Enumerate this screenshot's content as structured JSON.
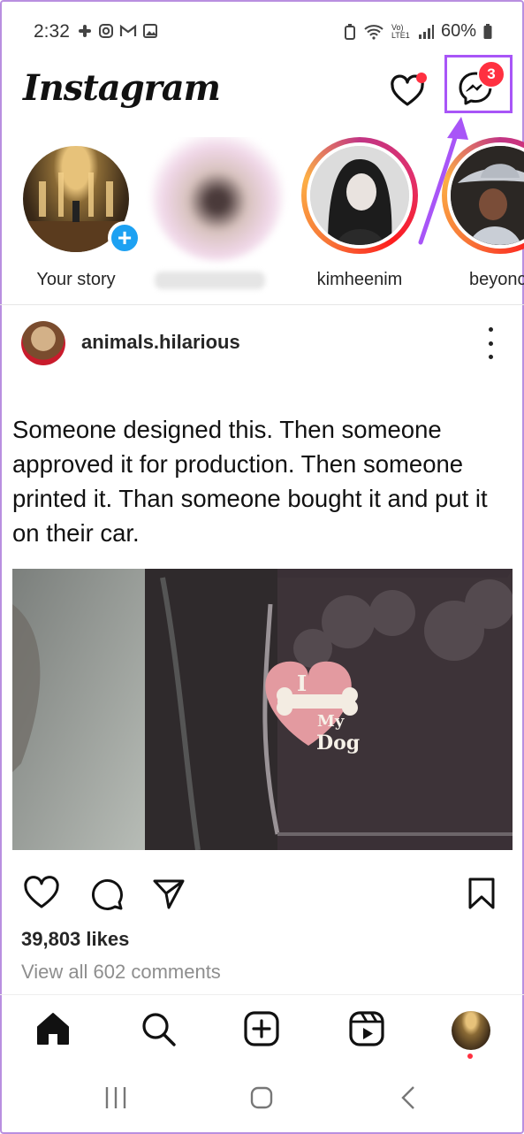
{
  "status_bar": {
    "time": "2:32",
    "battery": "60%",
    "network": "Vo) LTE1"
  },
  "header": {
    "logo": "Instagram",
    "messages_badge": "3"
  },
  "stories": [
    {
      "label": "Your story"
    },
    {
      "label": ""
    },
    {
      "label": "kimheenim"
    },
    {
      "label": "beyonc"
    }
  ],
  "post": {
    "username": "animals.hilarious",
    "caption": "Someone designed this. Then someone approved it for production. Then someone printed it. Than someone bought it and put it on their car.",
    "sticker_text": [
      "I",
      "My",
      "Dog"
    ],
    "likes": "39,803 likes",
    "comments": "View all 602 comments"
  },
  "icons": {
    "activity": "heart-icon",
    "messages": "messenger-icon",
    "like": "heart-outline-icon",
    "comment": "comment-icon",
    "share": "send-icon",
    "save": "bookmark-icon",
    "home": "home-icon",
    "search": "search-icon",
    "create": "plus-square-icon",
    "reels": "reels-icon"
  },
  "colors": {
    "highlight": "#a855f7",
    "notification": "#ff3040",
    "story_plus": "#1da1f2"
  }
}
